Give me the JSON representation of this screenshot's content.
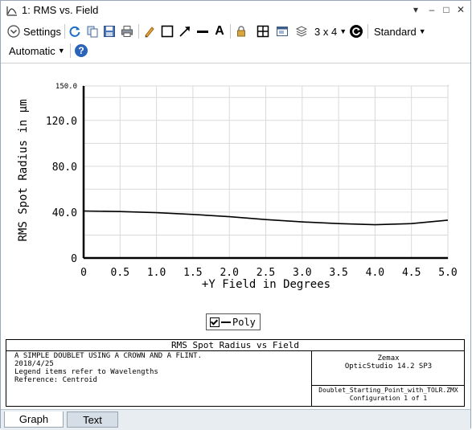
{
  "window": {
    "title": "1: RMS vs. Field",
    "controls": [
      "▾",
      "–",
      "□",
      "✕"
    ]
  },
  "toolbar": {
    "settings_label": "Settings",
    "layout_label": "3 x 4",
    "style_label": "Standard",
    "scale_label": "Automatic",
    "text_tool_label": "A"
  },
  "chart_data": {
    "type": "line",
    "xlabel": "+Y Field in Degrees",
    "ylabel": "RMS Spot Radius in µm",
    "xlim": [
      0,
      5.0
    ],
    "ylim": [
      0,
      150.0
    ],
    "x_ticks": [
      "0",
      "0.5",
      "1.0",
      "1.5",
      "2.0",
      "2.5",
      "3.0",
      "3.5",
      "4.0",
      "4.5",
      "5.0"
    ],
    "y_ticks": [
      "0",
      "40.0",
      "80.0",
      "120.0",
      "150.0"
    ],
    "grid": true,
    "legend_placement": "bottom-center",
    "series": [
      {
        "name": "Poly",
        "x": [
          0,
          0.5,
          1.0,
          1.5,
          2.0,
          2.5,
          3.0,
          3.5,
          4.0,
          4.5,
          5.0
        ],
        "y": [
          41.0,
          40.5,
          39.5,
          38.0,
          36.0,
          33.5,
          31.5,
          30.0,
          29.0,
          30.0,
          33.0
        ]
      }
    ]
  },
  "legend": {
    "item": "Poly"
  },
  "info": {
    "title": "RMS Spot Radius vs Field",
    "left_lines": [
      "A SIMPLE DOUBLET USING A CROWN AND A FLINT.",
      "2018/4/25",
      "Legend items refer to Wavelengths",
      "Reference: Centroid"
    ],
    "right_top": [
      "Zemax",
      "OpticStudio 14.2 SP3"
    ],
    "right_bottom": [
      "Doublet_Starting_Point_with_TOLR.ZMX",
      "Configuration 1 of 1"
    ]
  },
  "tabs": [
    "Graph",
    "Text"
  ],
  "colors": {
    "refresh_icon": "#1e6fc9",
    "help_icon": "#2a64b8"
  }
}
